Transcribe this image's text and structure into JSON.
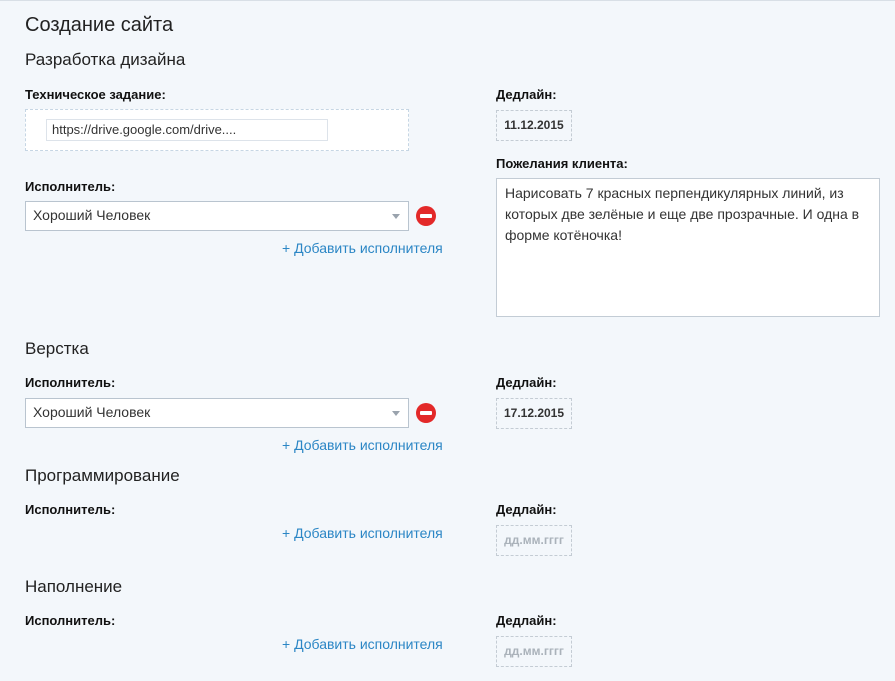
{
  "page": {
    "title": "Создание сайта"
  },
  "sections": {
    "design": {
      "title": "Разработка дизайна",
      "spec_label": "Техническое задание:",
      "spec_value": "https://drive.google.com/drive....",
      "executor_label": "Исполнитель:",
      "executor_value": "Хороший Человек",
      "add_executor": "+ Добавить исполнителя",
      "deadline_label": "Дедлайн:",
      "deadline_value": "11.12.2015",
      "wishes_label": "Пожелания клиента:",
      "wishes_value": "Нарисовать 7 красных перпендикулярных линий, из которых две зелёные и еще две прозрачные. И одна в форме котёночка!"
    },
    "layout": {
      "title": "Верстка",
      "executor_label": "Исполнитель:",
      "executor_value": "Хороший Человек",
      "add_executor": "+ Добавить исполнителя",
      "deadline_label": "Дедлайн:",
      "deadline_value": "17.12.2015"
    },
    "programming": {
      "title": "Программирование",
      "executor_label": "Исполнитель:",
      "add_executor": "+ Добавить исполнителя",
      "deadline_label": "Дедлайн:",
      "deadline_placeholder": "дд.мм.гггг"
    },
    "content": {
      "title": "Наполнение",
      "executor_label": "Исполнитель:",
      "add_executor": "+ Добавить исполнителя",
      "deadline_label": "Дедлайн:",
      "deadline_placeholder": "дд.мм.гггг"
    }
  },
  "icons": {
    "remove": "minus-circle-icon",
    "dropdown": "chevron-down-icon"
  },
  "colors": {
    "background": "#f3f7fb",
    "link": "#2b86c5",
    "remove": "#e32929"
  }
}
